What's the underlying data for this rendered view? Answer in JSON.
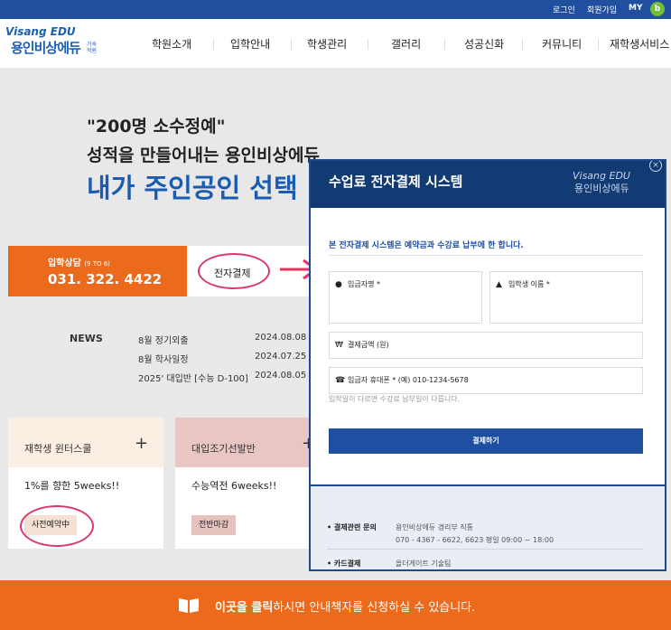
{
  "topbar": {
    "login": "로그인",
    "signup": "회원가입",
    "my": "MY",
    "badge": "b"
  },
  "logo": {
    "brand": "Visang EDU",
    "name": "용인비상에듀",
    "sub": "기숙학원"
  },
  "nav": [
    "학원소개",
    "입학안내",
    "학생관리",
    "갤러리",
    "성공신화",
    "커뮤니티",
    "재학생서비스"
  ],
  "hero": {
    "quote": "\"200명 소수정예\"",
    "line2": "성적을 만들어내는 용인비상에듀",
    "line3": "내가 주인공인 선택"
  },
  "consult": {
    "label": "입학상담",
    "hours": "(9 TO 6)",
    "phone": "031. 322. 4422"
  },
  "epay": {
    "label": "전자결제"
  },
  "news": {
    "title": "NEWS",
    "items": [
      {
        "text": "8월 정기외출",
        "date": "2024.08.08"
      },
      {
        "text": "8월 학사일정",
        "date": "2024.07.25"
      },
      {
        "text": "2025' 대입반 [수능 D-100]",
        "date": "2024.08.05"
      }
    ]
  },
  "cards": [
    {
      "title": "재학생 윈터스쿨",
      "body": "1%를 향한 5weeks!!",
      "tag": "사전예약中",
      "head_color": "#fbeee3",
      "tag_color": "#f5e0d4"
    },
    {
      "title": "대입조기선발반",
      "body": "수능역전 6weeks!!",
      "tag": "전반마감",
      "head_color": "#e9c6c4",
      "tag_color": "#e6c2bf"
    }
  ],
  "banner": {
    "strong": "이곳을 클릭",
    "rest": "하시면 안내책자를 신청하실 수 있습니다."
  },
  "modal": {
    "title": "수업료 전자결제 시스템",
    "logo_brand": "Visang EDU",
    "logo_name": "용인비상에듀",
    "close": "×",
    "notice": "본 전자결제 시스템은 예약금과 수강료 납부에 한 합니다.",
    "fields": {
      "payer": "입금자명 *",
      "student": "입학생 이름 *",
      "amount": "결제금액 (원)",
      "phone": "입금자 휴대폰 * (예) 010-1234-5678"
    },
    "hint": "입학일이 다르면 수강료 납부일이 다릅니다.",
    "pay_button": "결제하기",
    "footer": {
      "inquiry_label": "• 결제관련 문의",
      "inquiry_line1": "용인비상에듀 경리부 직통",
      "inquiry_line2": "070 - 4367 - 6622, 6623   평일 09:00 ~ 18:00",
      "card_label": "• 카드결제",
      "card_value": "올더게이트 기술팀"
    }
  }
}
